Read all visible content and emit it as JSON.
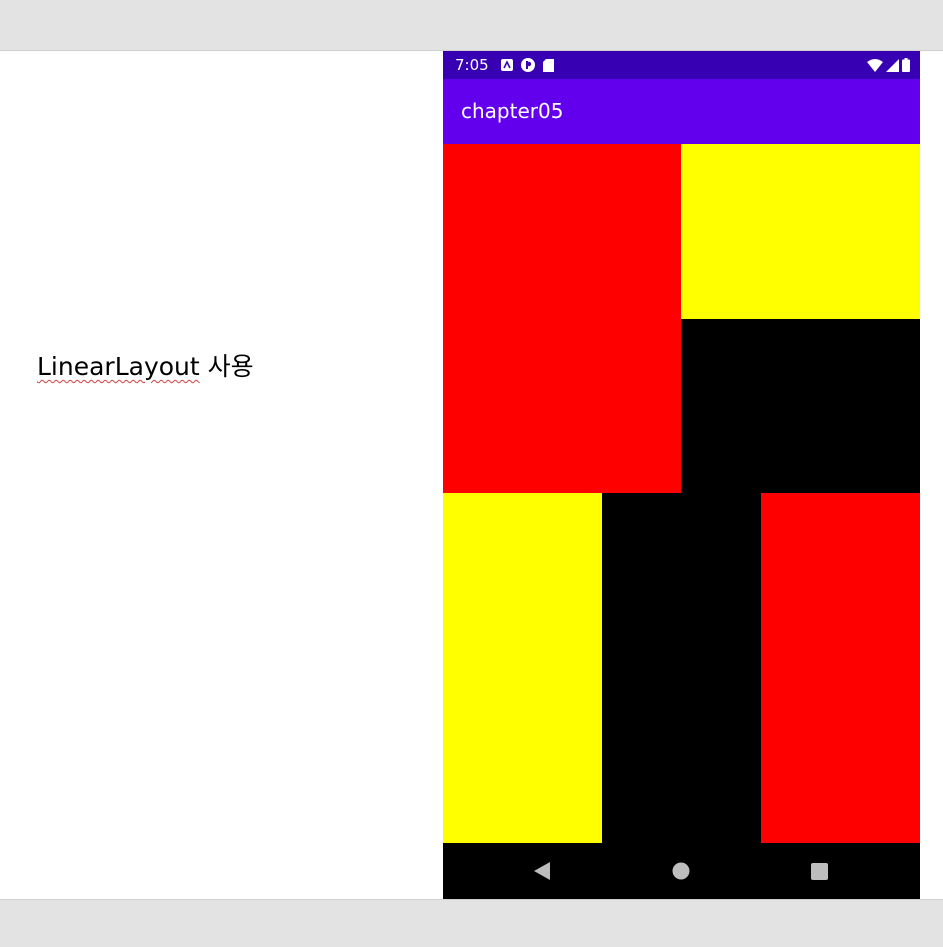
{
  "slide": {
    "caption_word": "LinearLayout",
    "caption_rest": " 사용"
  },
  "phone": {
    "status_bar": {
      "time": "7:05",
      "left_icons": [
        "a-notification-icon",
        "p-notification-icon",
        "sd-card-icon"
      ],
      "right_icons": [
        "wifi-icon",
        "cell-signal-icon",
        "battery-icon"
      ]
    },
    "app_bar": {
      "title": "chapter05",
      "color": "#6200ee",
      "status_color": "#3700b3"
    },
    "blocks": [
      {
        "name": "top-left-red-block",
        "color": "#ff0000"
      },
      {
        "name": "top-right-yellow-block",
        "color": "#ffff00"
      },
      {
        "name": "middle-right-black-block",
        "color": "#000000"
      },
      {
        "name": "bottom-left-yellow-block",
        "color": "#ffff00"
      },
      {
        "name": "bottom-middle-black-block",
        "color": "#000000"
      },
      {
        "name": "bottom-right-red-block",
        "color": "#ff0000"
      }
    ],
    "nav_bar": {
      "buttons": [
        "back-icon",
        "home-icon",
        "recents-icon"
      ]
    }
  }
}
